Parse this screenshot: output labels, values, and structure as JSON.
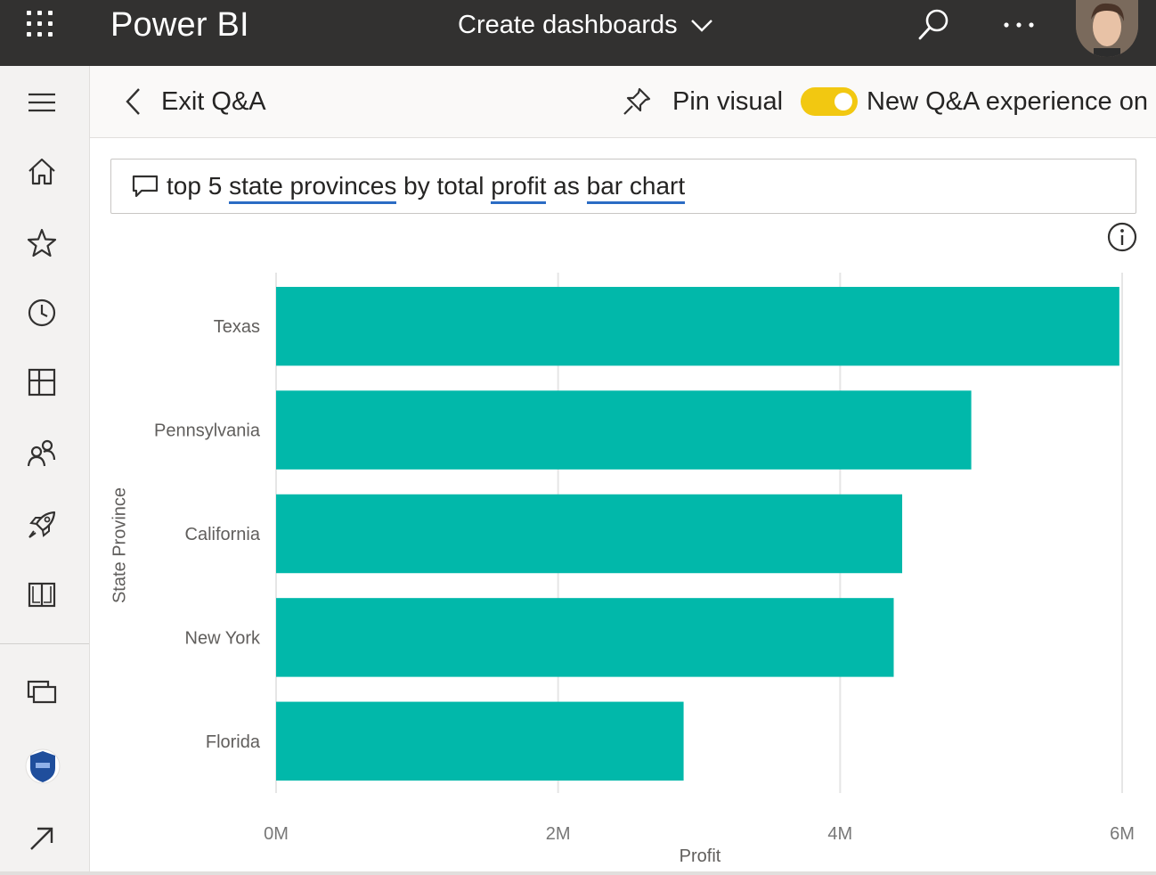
{
  "topbar": {
    "app_name": "Power BI",
    "workspace_label": "Create dashboards",
    "background": "#323130",
    "icons": [
      "app-launcher-icon",
      "chevron-down-icon",
      "search-icon",
      "more-options-icon",
      "user-avatar"
    ]
  },
  "left_rail": {
    "items": [
      {
        "icon": "hamburger-menu-icon"
      },
      {
        "icon": "home-icon"
      },
      {
        "icon": "favorites-star-icon"
      },
      {
        "icon": "recent-clock-icon"
      },
      {
        "icon": "apps-icon"
      },
      {
        "icon": "shared-with-me-icon"
      },
      {
        "icon": "deployment-rocket-icon"
      },
      {
        "icon": "learn-book-icon"
      },
      {
        "icon": "workspaces-icon"
      },
      {
        "icon": "workspace-badge-icon"
      },
      {
        "icon": "expand-arrow-icon"
      }
    ]
  },
  "command_bar": {
    "exit_label": "Exit Q&A",
    "pin_label": "Pin visual",
    "toggle_label": "New Q&A experience on",
    "toggle_on": true,
    "toggle_color": "#f2c811"
  },
  "qa": {
    "segments": [
      {
        "text": "top 5 ",
        "term": false
      },
      {
        "text": "state provinces",
        "term": true
      },
      {
        "text": " by total ",
        "term": false
      },
      {
        "text": "profit",
        "term": true
      },
      {
        "text": " as ",
        "term": false
      },
      {
        "text": "bar chart",
        "term": true
      }
    ],
    "underline_color": "#2b6cc4"
  },
  "chart_data": {
    "type": "bar",
    "orientation": "horizontal",
    "categories": [
      "Texas",
      "Pennsylvania",
      "California",
      "New York",
      "Florida"
    ],
    "values": [
      5980000,
      4930000,
      4440000,
      4380000,
      2890000
    ],
    "xlabel": "Profit",
    "ylabel": "State Province",
    "xlim": [
      0,
      6000000
    ],
    "x_ticks": [
      "0M",
      "2M",
      "4M",
      "6M"
    ],
    "x_tick_values": [
      0,
      2000000,
      4000000,
      6000000
    ],
    "grid": true,
    "bar_color": "#01b8aa"
  }
}
